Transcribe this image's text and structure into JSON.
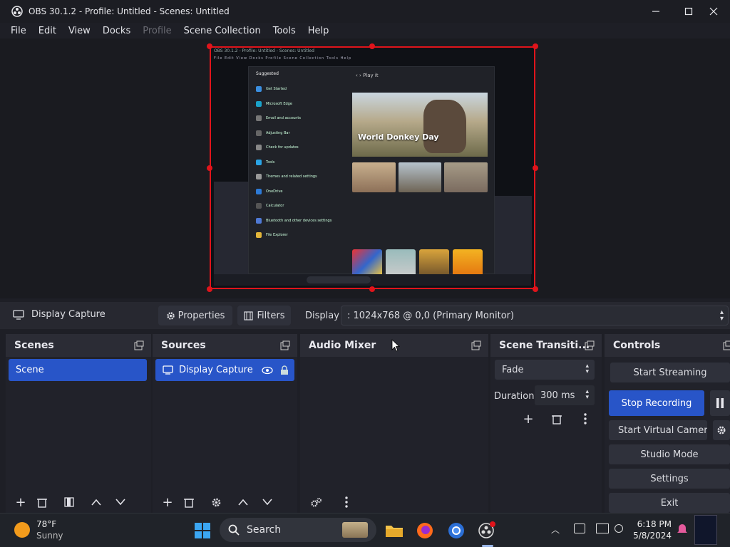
{
  "window": {
    "title": "OBS 30.1.2 - Profile: Untitled - Scenes: Untitled"
  },
  "menu": [
    "File",
    "Edit",
    "View",
    "Docks",
    "Profile",
    "Scene Collection",
    "Tools",
    "Help"
  ],
  "preview": {
    "inner_title": "OBS 30.1.2 - Profile: Untitled - Scenes: Untitled",
    "start_menu_header": "Suggested",
    "start_menu_items": [
      "Get Started",
      "Microsoft Edge",
      "Email and accounts",
      "Adjusting Bar",
      "Check for updates",
      "Tools",
      "Themes and related settings",
      "OneDrive",
      "Calculator",
      "Bluetooth and other devices settings",
      "File Explorer"
    ],
    "hero_title": "World Donkey Day",
    "play_label": "Play it"
  },
  "source_toolbar": {
    "source_name": "Display Capture",
    "properties_label": "Properties",
    "filters_label": "Filters",
    "display_label": "Display",
    "display_value": ": 1024x768 @ 0,0 (Primary Monitor)"
  },
  "docks": {
    "scenes": {
      "title": "Scenes",
      "items": [
        "Scene"
      ]
    },
    "sources": {
      "title": "Sources",
      "items": [
        "Display Capture"
      ]
    },
    "audio_mixer": {
      "title": "Audio Mixer"
    },
    "transitions": {
      "title": "Scene Transiti...",
      "transition": "Fade",
      "duration_label": "Duration",
      "duration_value": "300 ms"
    },
    "controls": {
      "title": "Controls",
      "start_streaming": "Start Streaming",
      "stop_recording": "Stop Recording",
      "start_virtual_camera": "Start Virtual Camera",
      "studio_mode": "Studio Mode",
      "settings": "Settings",
      "exit": "Exit"
    }
  },
  "taskbar": {
    "weather_temp": "78°F",
    "weather_desc": "Sunny",
    "search_label": "Search",
    "time": "6:18 PM",
    "date": "5/8/2024"
  },
  "colors": {
    "accent": "#2855c8",
    "selection_border": "#e0141b",
    "background": "#1e1f26"
  }
}
